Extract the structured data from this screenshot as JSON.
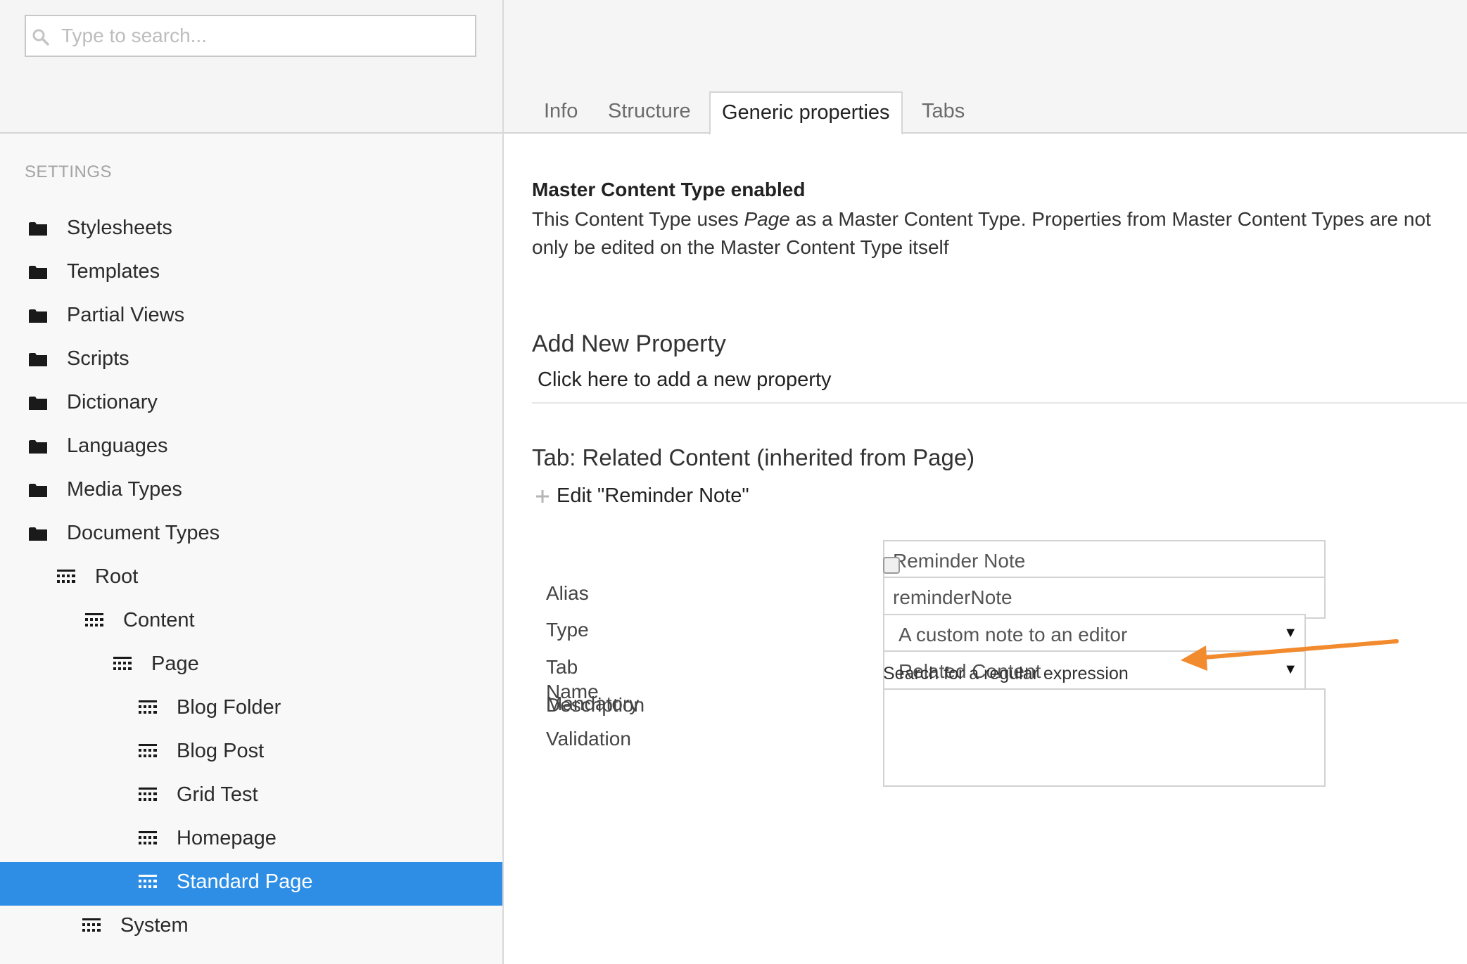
{
  "search": {
    "placeholder": "Type to search..."
  },
  "sidebar": {
    "section_title": "SETTINGS",
    "items": [
      {
        "label": "Stylesheets",
        "icon": "folder-icon"
      },
      {
        "label": "Templates",
        "icon": "folder-icon"
      },
      {
        "label": "Partial Views",
        "icon": "folder-icon"
      },
      {
        "label": "Scripts",
        "icon": "folder-icon"
      },
      {
        "label": "Dictionary",
        "icon": "folder-icon"
      },
      {
        "label": "Languages",
        "icon": "folder-icon"
      },
      {
        "label": "Media Types",
        "icon": "folder-icon"
      },
      {
        "label": "Document Types",
        "icon": "folder-icon"
      },
      {
        "label": "Root",
        "icon": "document-type-icon"
      },
      {
        "label": "Content",
        "icon": "document-type-icon"
      },
      {
        "label": "Page",
        "icon": "document-type-icon"
      },
      {
        "label": "Blog Folder",
        "icon": "document-type-icon"
      },
      {
        "label": "Blog Post",
        "icon": "document-type-icon"
      },
      {
        "label": "Grid Test",
        "icon": "document-type-icon"
      },
      {
        "label": "Homepage",
        "icon": "document-type-icon"
      },
      {
        "label": "Standard Page",
        "icon": "document-type-icon",
        "selected": true
      },
      {
        "label": "System",
        "icon": "document-type-icon"
      }
    ]
  },
  "tabs": [
    {
      "label": "Info"
    },
    {
      "label": "Structure"
    },
    {
      "label": "Generic properties",
      "active": true
    },
    {
      "label": "Tabs"
    }
  ],
  "main": {
    "master_title": "Master Content Type enabled",
    "master_desc_before": "This Content Type uses ",
    "master_desc_em": "Page",
    "master_desc_after": " as a Master Content Type. Properties from Master Content Types are not",
    "master_desc_line2": "only be edited on the Master Content Type itself",
    "add_property_title": "Add New Property",
    "add_property_link": "Click here to add a new property",
    "tab_title": "Tab: Related Content (inherited from Page)",
    "edit_label": "Edit \"Reminder Note\""
  },
  "form": {
    "name_label": "Name",
    "name_value": "Reminder Note",
    "alias_label": "Alias",
    "alias_value": "reminderNote",
    "type_label": "Type",
    "type_value": "A custom note to an editor",
    "tab_label": "Tab",
    "tab_value": "Related Content",
    "mandatory_label": "Mandatory",
    "mandatory_checked": false,
    "validation_label": "Validation",
    "regex_link": "Search for a regular expression",
    "description_label": "Description"
  },
  "colors": {
    "selected_item": "#2e8ee5",
    "annotation_arrow": "#f28a2e"
  }
}
